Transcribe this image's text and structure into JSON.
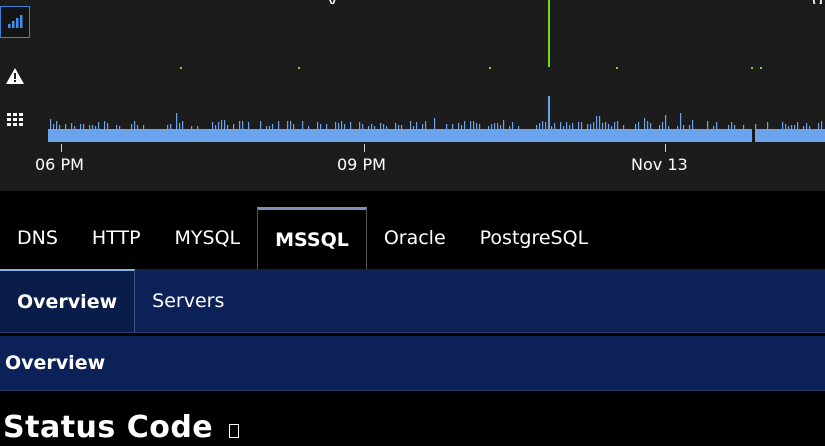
{
  "timeline": {
    "top_fragment_left": "y",
    "top_fragment_right": "g",
    "icons": [
      "bar-chart-icon",
      "warning-icon",
      "grid-icon"
    ],
    "axis_ticks": [
      "06 PM",
      "09 PM",
      "Nov 13"
    ]
  },
  "protocol_tabs": [
    "DNS",
    "HTTP",
    "MYSQL",
    "MSSQL",
    "Oracle",
    "PostgreSQL"
  ],
  "active_protocol": "MSSQL",
  "sub_tabs": [
    "Overview",
    "Servers"
  ],
  "active_sub_tab": "Overview",
  "section": {
    "title": "Overview"
  },
  "page": {
    "title": "Status Code"
  },
  "colors": {
    "bar_color": "#6ba4ec",
    "alert_color": "#7ed321",
    "sub_nav_bg": "#0c2158"
  }
}
